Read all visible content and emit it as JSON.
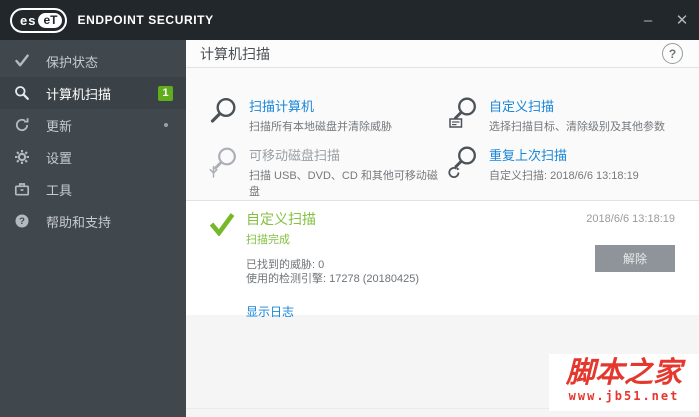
{
  "colors": {
    "accent_blue": "#1886d9",
    "success_green": "#84c143",
    "badge_green": "#60ad1d",
    "titlebar_bg": "#22272c",
    "sidebar_bg": "#40474d",
    "watermark_red": "#e4372e"
  },
  "titlebar": {
    "logo_left": "es",
    "logo_right": "eT",
    "brand": "ENDPOINT SECURITY",
    "minimize_label": "–",
    "close_label": "✕"
  },
  "sidebar": {
    "items": [
      {
        "label": "保护状态"
      },
      {
        "label": "计算机扫描",
        "badge": "1"
      },
      {
        "label": "更新"
      },
      {
        "label": "设置"
      },
      {
        "label": "工具"
      },
      {
        "label": "帮助和支持"
      }
    ]
  },
  "header": {
    "title": "计算机扫描",
    "help": "?"
  },
  "scan_options": [
    {
      "title": "扫描计算机",
      "subtitle": "扫描所有本地磁盘并清除威胁"
    },
    {
      "title": "自定义扫描",
      "subtitle": "选择扫描目标、清除级别及其他参数"
    },
    {
      "title": "可移动磁盘扫描",
      "subtitle": "扫描 USB、DVD、CD 和其他可移动磁盘"
    },
    {
      "title": "重复上次扫描",
      "subtitle": "自定义扫描: 2018/6/6 13:18:19"
    }
  ],
  "result": {
    "title": "自定义扫描",
    "status": "扫描完成",
    "threats_found": "已找到的威胁: 0",
    "engine_used": "使用的检测引擎: 17278 (20180425)",
    "show_log": "显示日志",
    "timestamp": "2018/6/6 13:18:19",
    "dismiss": "解除"
  },
  "watermark": {
    "site_name": "脚本之家",
    "site_url": "www.jb51.net"
  }
}
